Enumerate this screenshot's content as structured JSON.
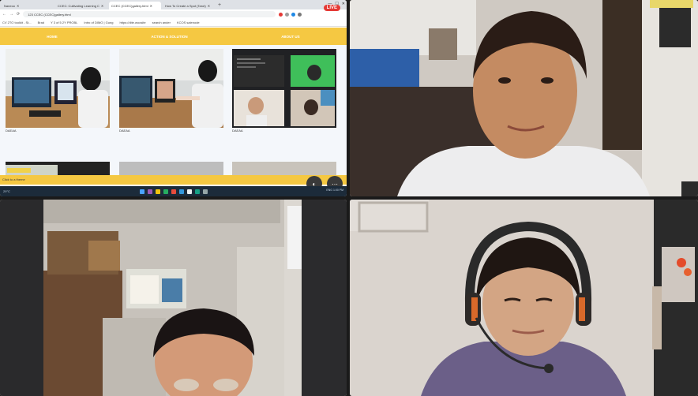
{
  "browser": {
    "tabs": [
      {
        "label": "Naneoo"
      },
      {
        "label": "CCEC: Cultivating Learning C"
      },
      {
        "label": "CCEC (CCEC)gallery.html"
      },
      {
        "label": "How To Create a Spot (Tarot)"
      }
    ],
    "url": "123  CCEC (CCEC)gallery.html",
    "bookmarks": [
      "CV 2TO toolkit - St...",
      "Brad",
      "Y 3 of 5 2Y PROBL",
      "Intro of DIMO | Gung",
      "https://dite.woosite",
      "search ander",
      "KCOS salenode"
    ]
  },
  "live_badge": "LIVE",
  "site": {
    "nav": [
      "HOME",
      "ACTION & SOLUTION",
      "ABOUT US"
    ],
    "captions": [
      "DAEAA",
      "DAEAA",
      "DAEAA"
    ],
    "footer_text": "Click to a theme"
  },
  "taskbar": {
    "left_text": "29°C",
    "right_text": "ENG 1:00 PM"
  },
  "controls": {
    "audio_icon": "speaker-icon",
    "more_icon": "more-icon"
  }
}
